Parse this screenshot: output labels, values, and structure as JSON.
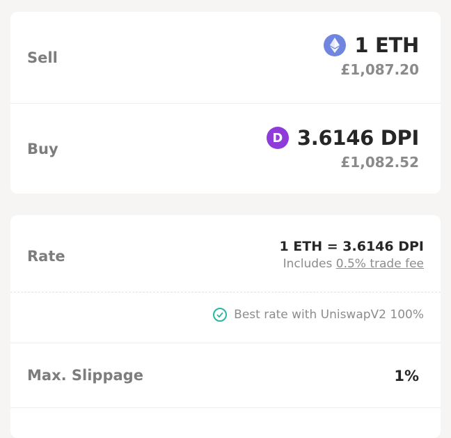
{
  "sell": {
    "label": "Sell",
    "token_icon": "ethereum-icon",
    "amount": "1 ETH",
    "fiat": "£1,087.20"
  },
  "buy": {
    "label": "Buy",
    "token_icon": "dpi-icon",
    "icon_letter": "D",
    "amount": "3.6146 DPI",
    "fiat": "£1,082.52"
  },
  "details": {
    "rate_label": "Rate",
    "rate_value": "1 ETH = 3.6146 DPI",
    "includes_prefix": "Includes",
    "fee_link": "0.5% trade fee",
    "best_rate_icon": "check-circle-icon",
    "best_rate_text": "Best rate with UniswapV2 100%",
    "slippage_label": "Max. Slippage",
    "slippage_value": "1%"
  },
  "colors": {
    "eth": "#6f85e0",
    "dpi": "#8e3bd9",
    "success": "#25b7a4"
  }
}
